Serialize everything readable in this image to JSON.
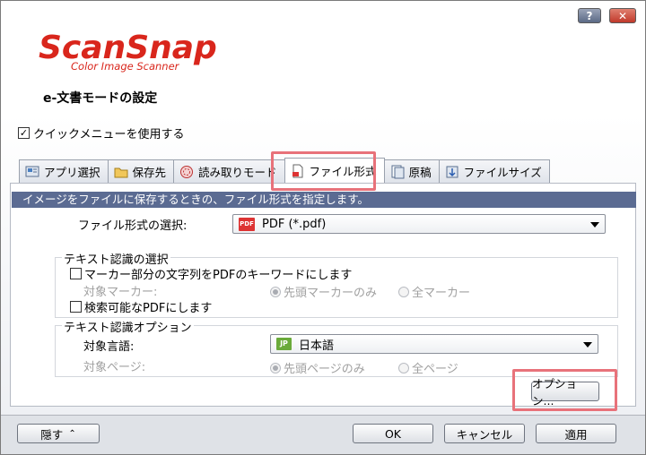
{
  "window": {
    "help_label": "?",
    "close_label": "✕"
  },
  "logo": {
    "brand": "ScanSnap",
    "tagline": "Color Image Scanner",
    "color": "#d9261c"
  },
  "title": "e-文書モードの設定",
  "quick_menu": {
    "checked": true,
    "label": "クイックメニューを使用する"
  },
  "tabs": [
    {
      "label": "アプリ選択",
      "icon": "app-select-icon"
    },
    {
      "label": "保存先",
      "icon": "folder-icon"
    },
    {
      "label": "読み取りモード",
      "icon": "scan-mode-icon"
    },
    {
      "label": "ファイル形式",
      "icon": "file-format-icon",
      "active": true
    },
    {
      "label": "原稿",
      "icon": "document-icon"
    },
    {
      "label": "ファイルサイズ",
      "icon": "file-size-icon"
    }
  ],
  "info_bar": "イメージをファイルに保存するときの、ファイル形式を指定します。",
  "file_format": {
    "label": "ファイル形式の選択:",
    "value": "PDF (*.pdf)",
    "icon_text": "PDF"
  },
  "text_recognition": {
    "group_label": "テキスト認識の選択",
    "marker_checkbox_label": "マーカー部分の文字列をPDFのキーワードにします",
    "target_marker_label": "対象マーカー:",
    "radio_first_marker": "先頭マーカーのみ",
    "radio_all_markers": "全マーカー",
    "searchable_pdf_label": "検索可能なPDFにします"
  },
  "text_options": {
    "group_label": "テキスト認識オプション",
    "language_label": "対象言語:",
    "language_value": "日本語",
    "language_icon_text": "JP",
    "page_label": "対象ページ:",
    "radio_first_page": "先頭ページのみ",
    "radio_all_pages": "全ページ",
    "option_button": "オプション..."
  },
  "footer": {
    "hide_button": "隠す",
    "ok_button": "OK",
    "cancel_button": "キャンセル",
    "apply_button": "適用"
  },
  "colors": {
    "info_bar": "#5b6b92",
    "highlight": "#e8727a"
  }
}
